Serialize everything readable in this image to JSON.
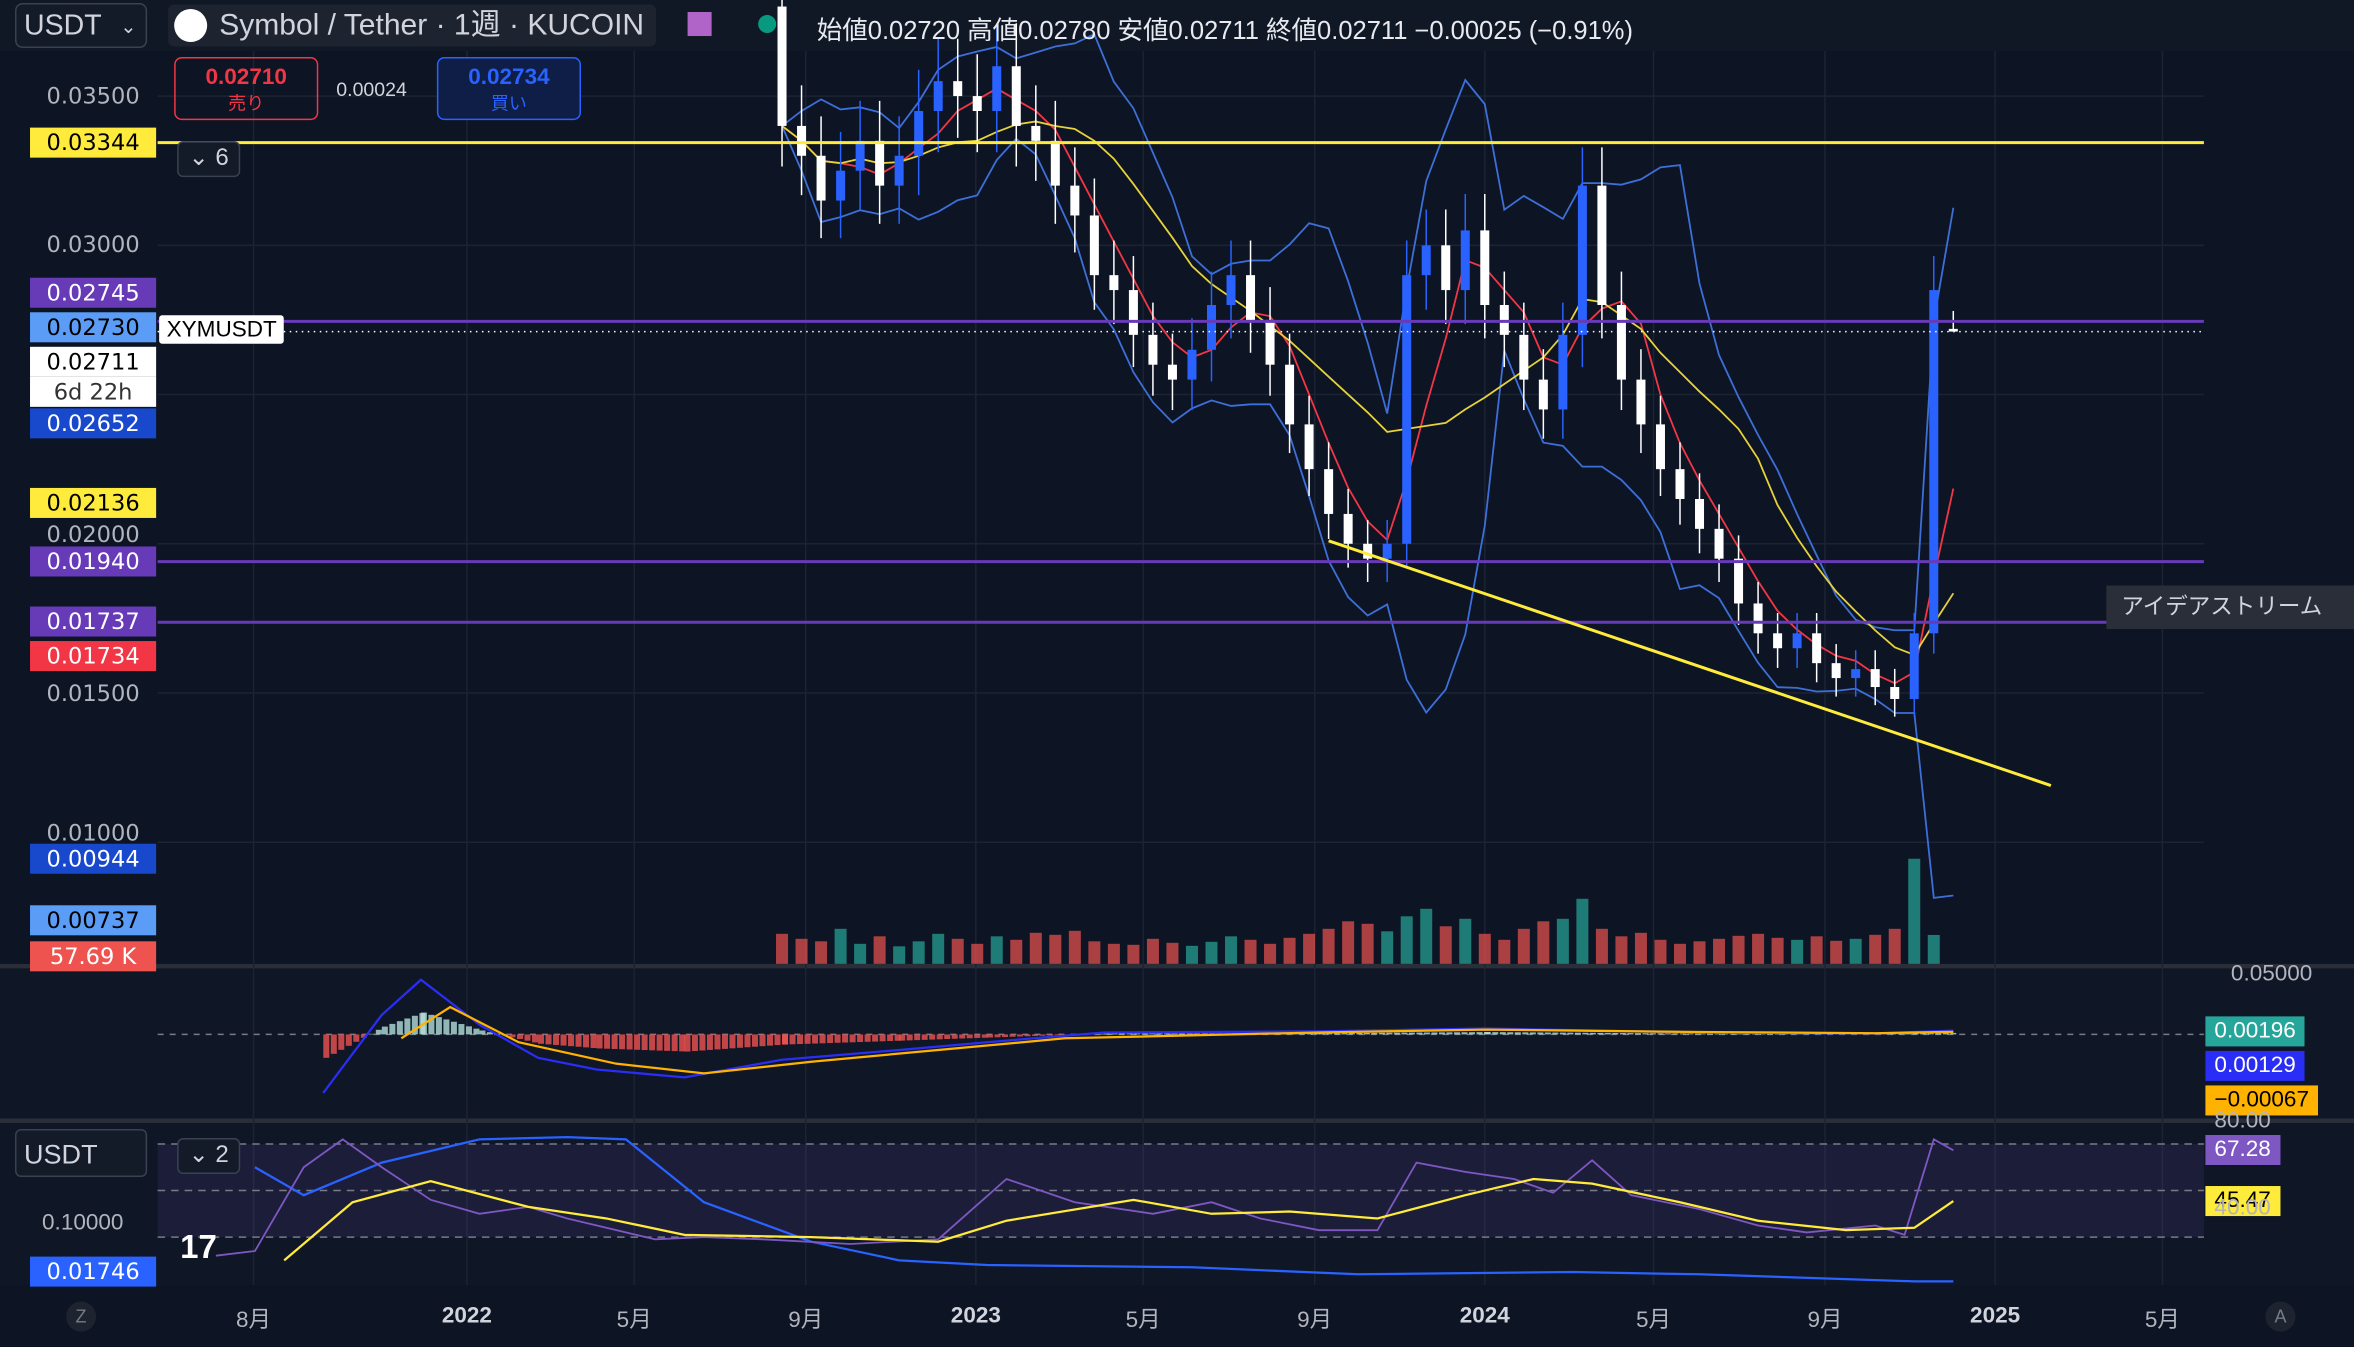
{
  "header": {
    "currency": "USDT",
    "title": "Symbol / Tether · 1週 · KUCOIN",
    "ohlc": "始値0.02720 高値0.02780 安値0.02711 終値0.02711 −0.00025 (−0.91%)"
  },
  "trade": {
    "sell_price": "0.02710",
    "sell_label": "売り",
    "spread": "0.00024",
    "buy_price": "0.02734",
    "buy_label": "買い"
  },
  "indicator_collapse": {
    "count": "6"
  },
  "rsi_collapse": {
    "count": "2",
    "currency": "USDT"
  },
  "symbol_tag": "XYMUSDT",
  "ideas_stream": "アイデアストリーム",
  "colors": {
    "background": "#0d1424",
    "up": "#2962ff",
    "down": "#ffffff",
    "yellow": "#ffeb3b",
    "purple": "#673ab7",
    "bb": "#3d6fd8",
    "ma_red": "#f23645",
    "ma_yellow": "#e6d23a",
    "vol_up": "#26a69a",
    "vol_down": "#ef5350"
  },
  "price_axis": [
    {
      "text": "0.03500",
      "value": 0.035,
      "bg": "",
      "fg": "#b2b5be"
    },
    {
      "text": "0.03344",
      "value": 0.03344,
      "bg": "#ffeb3b",
      "fg": "#000"
    },
    {
      "text": "0.03000",
      "value": 0.03,
      "bg": "",
      "fg": "#b2b5be"
    },
    {
      "text": "0.02745",
      "value": 0.0284,
      "bg": "#673ab7",
      "fg": "#fff"
    },
    {
      "text": "0.02730",
      "value": 0.02725,
      "bg": "#5b9cf6",
      "fg": "#000"
    },
    {
      "text": "0.02711",
      "value": 0.0261,
      "bg": "#ffffff",
      "fg": "#000"
    },
    {
      "text": "6d 22h",
      "value": 0.0251,
      "bg": "#ffffff",
      "fg": "#333"
    },
    {
      "text": "0.02652",
      "value": 0.02405,
      "bg": "#1848cc",
      "fg": "#fff"
    },
    {
      "text": "0.02136",
      "value": 0.02136,
      "bg": "#ffeb3b",
      "fg": "#000"
    },
    {
      "text": "0.02000",
      "value": 0.0203,
      "bg": "",
      "fg": "#b2b5be"
    },
    {
      "text": "0.01940",
      "value": 0.0194,
      "bg": "#673ab7",
      "fg": "#fff"
    },
    {
      "text": "0.01737",
      "value": 0.01737,
      "bg": "#673ab7",
      "fg": "#fff"
    },
    {
      "text": "0.01734",
      "value": 0.01622,
      "bg": "#f23645",
      "fg": "#fff"
    },
    {
      "text": "0.01500",
      "value": 0.015,
      "bg": "",
      "fg": "#b2b5be"
    },
    {
      "text": "0.01000",
      "value": 0.0103,
      "bg": "",
      "fg": "#b2b5be"
    },
    {
      "text": "0.00944",
      "value": 0.00944,
      "bg": "#1848cc",
      "fg": "#fff"
    },
    {
      "text": "0.00737",
      "value": 0.00737,
      "bg": "#5b9cf6",
      "fg": "#000"
    },
    {
      "text": "57.69 K",
      "value": 0.0062,
      "bg": "#ef5350",
      "fg": "#fff"
    }
  ],
  "hlines": [
    {
      "value": 0.03344,
      "color": "#ffeb3b"
    },
    {
      "value": 0.02745,
      "color": "#673ab7"
    },
    {
      "value": 0.0194,
      "color": "#673ab7"
    },
    {
      "value": 0.01737,
      "color": "#673ab7"
    }
  ],
  "trendline": [
    {
      "date": "2023-09-11",
      "value": 0.0201
    },
    {
      "date": "2025-02-10",
      "value": 0.0119
    }
  ],
  "macd_axis": [
    {
      "text": "0.05000",
      "bg": "",
      "fg": "#b2b5be"
    },
    {
      "text": "0.00196",
      "bg": "#26a69a",
      "fg": "#fff"
    },
    {
      "text": "0.00129",
      "bg": "#2a2ef5",
      "fg": "#fff"
    },
    {
      "text": "−0.00067",
      "bg": "#ffb300",
      "fg": "#000"
    }
  ],
  "rsi_axis": [
    {
      "text": "80.00",
      "value": 80,
      "bg": "",
      "fg": "#b2b5be"
    },
    {
      "text": "67.28",
      "value": 67.28,
      "bg": "#7e57c2",
      "fg": "#fff"
    },
    {
      "text": "45.47",
      "value": 45.47,
      "bg": "#ffeb3b",
      "fg": "#000"
    },
    {
      "text": "40.00",
      "value": 42,
      "bg": "",
      "fg": "#b2b5be"
    }
  ],
  "rsi_left": {
    "text": "0.10000",
    "badge": "0.01746"
  },
  "time_axis": [
    {
      "label": "8月",
      "date": "2021-08-01",
      "year": false
    },
    {
      "label": "2022",
      "date": "2022-01-01",
      "year": true
    },
    {
      "label": "5月",
      "date": "2022-05-01",
      "year": false
    },
    {
      "label": "9月",
      "date": "2022-09-01",
      "year": false
    },
    {
      "label": "2023",
      "date": "2023-01-01",
      "year": true
    },
    {
      "label": "5月",
      "date": "2023-05-01",
      "year": false
    },
    {
      "label": "9月",
      "date": "2023-09-01",
      "year": false
    },
    {
      "label": "2024",
      "date": "2024-01-01",
      "year": true
    },
    {
      "label": "5月",
      "date": "2024-05-01",
      "year": false
    },
    {
      "label": "9月",
      "date": "2024-09-01",
      "year": false
    },
    {
      "label": "2025",
      "date": "2025-01-01",
      "year": true
    },
    {
      "label": "5月",
      "date": "2025-05-01",
      "year": false
    }
  ],
  "time_buttons": {
    "left": "Z",
    "right": "A"
  },
  "chart_data": {
    "type": "candlestick",
    "start": "2022-08-15",
    "interval_days": 14,
    "first_open": 0.038,
    "closes": [
      0.034,
      0.033,
      0.0315,
      0.0325,
      0.0335,
      0.032,
      0.033,
      0.0345,
      0.0355,
      0.035,
      0.0345,
      0.036,
      0.034,
      0.0335,
      0.032,
      0.031,
      0.029,
      0.0285,
      0.027,
      0.026,
      0.0255,
      0.0265,
      0.028,
      0.029,
      0.0275,
      0.026,
      0.024,
      0.0225,
      0.021,
      0.02,
      0.0195,
      0.02,
      0.029,
      0.03,
      0.0285,
      0.0305,
      0.028,
      0.027,
      0.0255,
      0.0245,
      0.027,
      0.032,
      0.028,
      0.0255,
      0.024,
      0.0225,
      0.0215,
      0.0205,
      0.0195,
      0.018,
      0.017,
      0.0165,
      0.017,
      0.016,
      0.0155,
      0.0158,
      0.0152,
      0.0148,
      0.017,
      0.0285
    ],
    "last": {
      "date": "2024-12-02",
      "open": 0.0272,
      "high": 0.0278,
      "low": 0.02711,
      "close": 0.02711
    },
    "volume_k": [
      60,
      50,
      45,
      70,
      40,
      55,
      35,
      45,
      60,
      50,
      40,
      55,
      48,
      62,
      58,
      66,
      45,
      40,
      38,
      50,
      42,
      36,
      44,
      55,
      48,
      40,
      52,
      60,
      70,
      85,
      80,
      65,
      95,
      110,
      75,
      90,
      60,
      48,
      70,
      85,
      90,
      130,
      70,
      55,
      62,
      48,
      40,
      45,
      50,
      56,
      60,
      52,
      48,
      55,
      46,
      50,
      58,
      70,
      210,
      57.69
    ],
    "macd": [
      [
        "2021-09-20",
        -0.03
      ],
      [
        "2021-11-01",
        0.01
      ],
      [
        "2021-11-29",
        0.028
      ],
      [
        "2022-01-10",
        0.005
      ],
      [
        "2022-02-21",
        -0.012
      ],
      [
        "2022-04-04",
        -0.018
      ],
      [
        "2022-06-06",
        -0.022
      ],
      [
        "2022-08-15",
        -0.013
      ],
      [
        "2022-11-07",
        -0.008
      ],
      [
        "2023-01-09",
        -0.004
      ],
      [
        "2023-04-03",
        0.001
      ],
      [
        "2023-09-04",
        0.0015
      ],
      [
        "2024-01-01",
        0.003
      ],
      [
        "2024-06-03",
        0.001
      ],
      [
        "2024-10-07",
        0.0005
      ],
      [
        "2024-12-02",
        0.00196
      ]
    ],
    "signal": [
      [
        "2021-11-15",
        -0.002
      ],
      [
        "2021-12-20",
        0.014
      ],
      [
        "2022-02-07",
        -0.004
      ],
      [
        "2022-04-18",
        -0.015
      ],
      [
        "2022-06-20",
        -0.02
      ],
      [
        "2022-09-05",
        -0.014
      ],
      [
        "2022-12-05",
        -0.008
      ],
      [
        "2023-03-06",
        -0.002
      ],
      [
        "2023-09-04",
        0.001
      ],
      [
        "2024-01-01",
        0.0025
      ],
      [
        "2024-06-03",
        0.0012
      ],
      [
        "2024-10-07",
        0.0006
      ],
      [
        "2024-12-02",
        0.00129
      ]
    ],
    "rsi": [
      [
        "2021-07-05",
        22
      ],
      [
        "2021-08-02",
        24
      ],
      [
        "2021-09-06",
        60
      ],
      [
        "2021-10-04",
        72
      ],
      [
        "2021-11-01",
        60
      ],
      [
        "2021-12-06",
        46
      ],
      [
        "2022-01-10",
        40
      ],
      [
        "2022-02-14",
        43
      ],
      [
        "2022-03-14",
        38
      ],
      [
        "2022-04-11",
        34
      ],
      [
        "2022-05-16",
        29
      ],
      [
        "2022-06-20",
        30
      ],
      [
        "2022-08-01",
        29
      ],
      [
        "2022-10-03",
        27
      ],
      [
        "2022-12-05",
        29
      ],
      [
        "2023-01-23",
        55
      ],
      [
        "2023-03-13",
        45
      ],
      [
        "2023-05-08",
        40
      ],
      [
        "2023-06-19",
        45
      ],
      [
        "2023-07-24",
        38
      ],
      [
        "2023-09-04",
        33
      ],
      [
        "2023-10-16",
        33
      ],
      [
        "2023-11-13",
        62
      ],
      [
        "2023-12-18",
        58
      ],
      [
        "2024-01-22",
        55
      ],
      [
        "2024-02-19",
        49
      ],
      [
        "2024-03-18",
        63
      ],
      [
        "2024-04-15",
        48
      ],
      [
        "2024-06-03",
        42
      ],
      [
        "2024-07-15",
        35
      ],
      [
        "2024-08-19",
        32
      ],
      [
        "2024-10-07",
        35
      ],
      [
        "2024-10-28",
        31
      ],
      [
        "2024-11-18",
        72
      ],
      [
        "2024-12-02",
        67.28
      ]
    ],
    "rsi_ma": [
      [
        "2021-08-23",
        20
      ],
      [
        "2021-10-11",
        45
      ],
      [
        "2021-12-06",
        54
      ],
      [
        "2022-02-14",
        43
      ],
      [
        "2022-04-11",
        38
      ],
      [
        "2022-06-06",
        31
      ],
      [
        "2022-09-05",
        30
      ],
      [
        "2022-12-05",
        28
      ],
      [
        "2023-01-23",
        37
      ],
      [
        "2023-04-24",
        46
      ],
      [
        "2023-06-19",
        40
      ],
      [
        "2023-08-14",
        41
      ],
      [
        "2023-10-16",
        38
      ],
      [
        "2023-12-18",
        48
      ],
      [
        "2024-02-05",
        55
      ],
      [
        "2024-03-18",
        53
      ],
      [
        "2024-05-20",
        45
      ],
      [
        "2024-07-15",
        37
      ],
      [
        "2024-09-16",
        33
      ],
      [
        "2024-11-04",
        34
      ],
      [
        "2024-12-02",
        45.47
      ]
    ],
    "rsi_line3": [
      [
        "2021-08-02",
        60
      ],
      [
        "2021-09-06",
        48
      ],
      [
        "2021-11-01",
        62
      ],
      [
        "2022-01-10",
        72
      ],
      [
        "2022-03-14",
        73
      ],
      [
        "2022-04-25",
        72
      ],
      [
        "2022-06-20",
        45
      ],
      [
        "2022-09-05",
        28
      ],
      [
        "2022-11-07",
        20
      ],
      [
        "2023-01-09",
        18
      ],
      [
        "2023-06-05",
        17
      ],
      [
        "2023-10-02",
        14
      ],
      [
        "2024-03-04",
        15
      ],
      [
        "2024-06-03",
        14
      ],
      [
        "2024-11-04",
        11
      ],
      [
        "2024-12-02",
        11
      ]
    ],
    "rsi_levels": [
      70,
      50,
      30
    ]
  }
}
